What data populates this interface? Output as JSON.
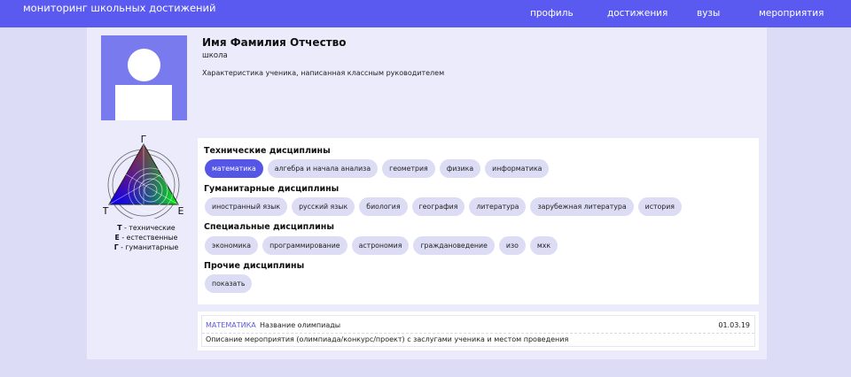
{
  "header": {
    "brand": "мониторинг школьных достижений",
    "nav": [
      {
        "label": "профиль"
      },
      {
        "label": "достижения"
      },
      {
        "label": "вузы"
      },
      {
        "label": "мероприятия"
      }
    ]
  },
  "profile": {
    "name": "Имя Фамилия Отчество",
    "school": "школа",
    "characteristic": "Характеристика ученика, написанная классным руководителем"
  },
  "triangle": {
    "labels": {
      "top": "Г",
      "left": "Т",
      "right": "Е"
    },
    "colors": {
      "top": "#ff1a1a",
      "left": "#1a1aff",
      "right": "#1aff1a"
    },
    "legend": [
      {
        "key": "Т",
        "text": " - технические"
      },
      {
        "key": "Е",
        "text": " - естественные"
      },
      {
        "key": "Г",
        "text": " - гуманитарные"
      }
    ]
  },
  "disciplines": {
    "groups": [
      {
        "title": "Технические дисциплины",
        "items": [
          "математика",
          "алгебра и начала анализа",
          "геометрия",
          "физика",
          "информатика"
        ]
      },
      {
        "title": "Гуманитарные дисциплины",
        "items": [
          "иностранный язык",
          "русский язык",
          "биология",
          "география",
          "литература",
          "зарубежная литература",
          "история"
        ]
      },
      {
        "title": "Специальные дисциплины",
        "items": [
          "экономика",
          "программирование",
          "астрономия",
          "граждановедение",
          "изо",
          "мхк"
        ]
      },
      {
        "title": "Прочие дисциплины",
        "items": [
          "показать"
        ]
      }
    ],
    "active": "математика"
  },
  "event": {
    "subject": "МАТЕМАТИКА",
    "title": "Название олимпиады",
    "date": "01.03.19",
    "description": "Описание мероприятия (олимпиада/конкурс/проект) с заслугами ученика и местом проведения"
  },
  "colors": {
    "accent": "#5b5af0",
    "chip": "#dcdcf5",
    "chip_active": "#5656e6"
  }
}
